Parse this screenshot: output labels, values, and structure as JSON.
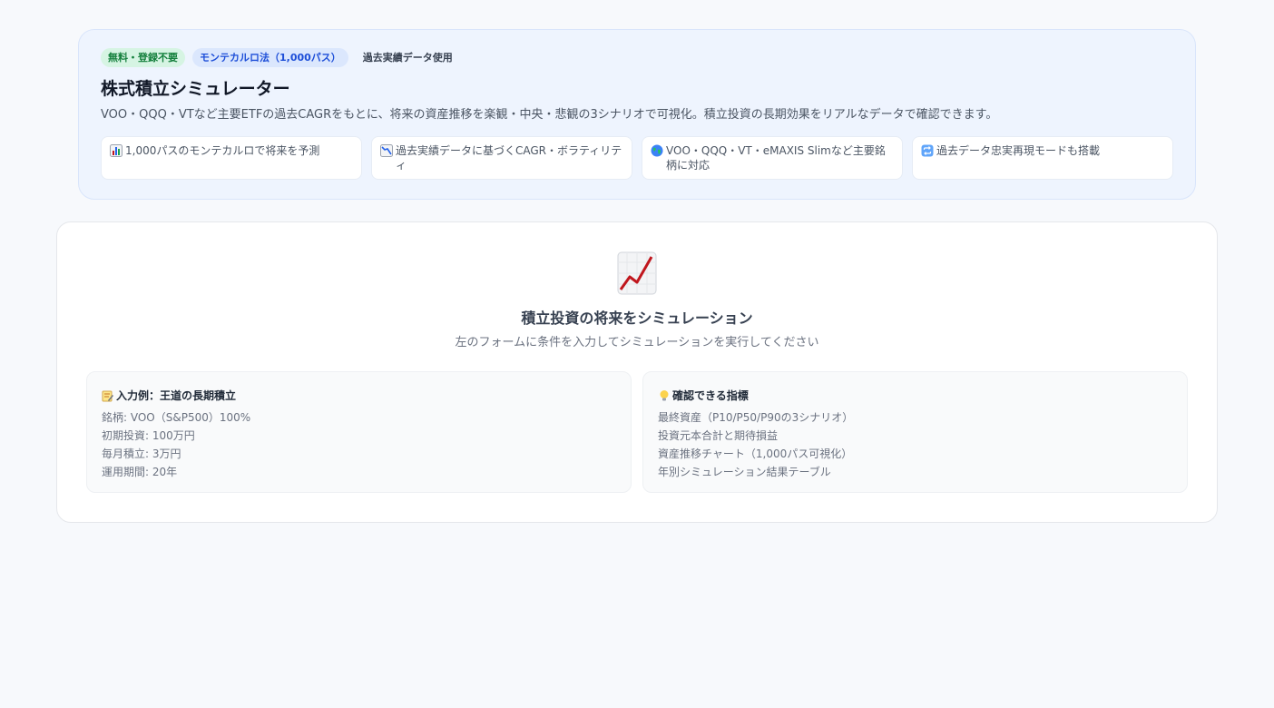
{
  "hero": {
    "badges": {
      "free": "無料・登録不要",
      "method": "モンテカルロ法（1,000パス）",
      "data": "過去実績データ使用"
    },
    "title": "株式積立シミュレーター",
    "description": "VOO・QQQ・VTなど主要ETFの過去CAGRをもとに、将来の資産推移を楽観・中央・悲観の3シナリオで可視化。積立投資の長期効果をリアルなデータで確認できます。",
    "features": [
      {
        "icon": "bar-chart-icon",
        "text": "1,000パスのモンテカルロで将来を予測"
      },
      {
        "icon": "chart-decreasing-icon",
        "text": "過去実績データに基づくCAGR・ボラティリティ"
      },
      {
        "icon": "globe-icon",
        "text": "VOO・QQQ・VT・eMAXIS Slimなど主要銘柄に対応"
      },
      {
        "icon": "repeat-icon",
        "text": "過去データ忠実再現モードも搭載"
      }
    ]
  },
  "main": {
    "icon": "chart-increasing-icon",
    "title": "積立投資の将来をシミュレーション",
    "subtitle": "左のフォームに条件を入力してシミュレーションを実行してください",
    "example": {
      "icon": "memo-icon",
      "title": "入力例：王道の長期積立",
      "items": [
        "銘柄: VOO（S&P500）100%",
        "初期投資: 100万円",
        "毎月積立: 3万円",
        "運用期間: 20年"
      ]
    },
    "metrics": {
      "icon": "light-bulb-icon",
      "title": "確認できる指標",
      "items": [
        "最終資産（P10/P50/P90の3シナリオ）",
        "投資元本合計と期待損益",
        "資産推移チャート（1,000パス可視化）",
        "年別シミュレーション結果テーブル"
      ]
    }
  },
  "colors": {
    "page_bg": "#f7f9fc",
    "hero_bg": "#eef4fe",
    "badge_free_bg": "#d6f4e3",
    "badge_free_text": "#15803d",
    "badge_method_bg": "#dbe7fd",
    "badge_method_text": "#1d4ed8",
    "chart_line": "#c0161d"
  }
}
